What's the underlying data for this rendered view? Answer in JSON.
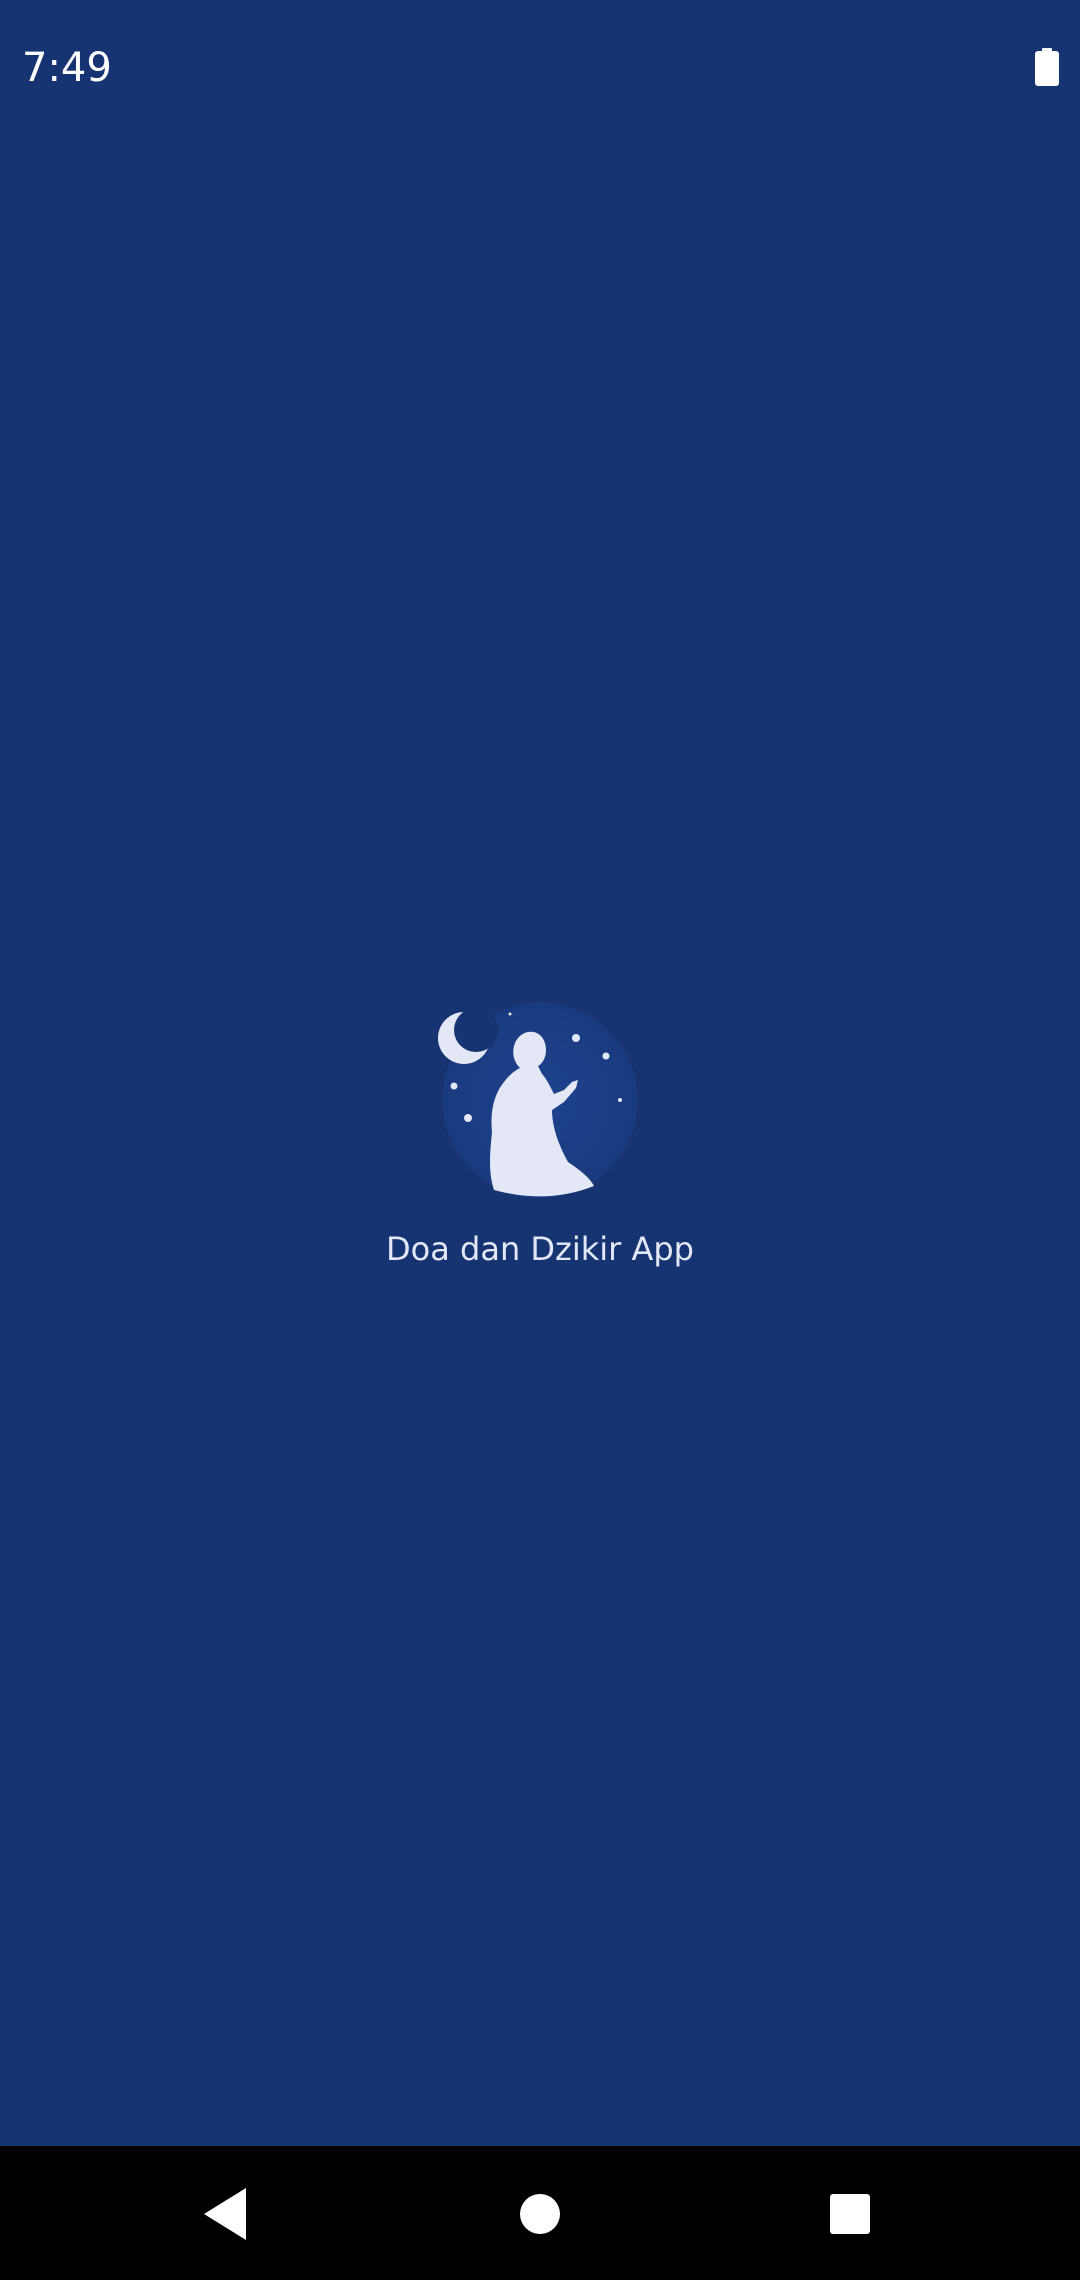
{
  "status_bar": {
    "time": "7:49",
    "battery_icon": "battery-full-icon"
  },
  "splash": {
    "app_name": "Doa dan Dzikir App",
    "logo_icon": "praying-man-moon-logo"
  },
  "nav_bar": {
    "back_icon": "back-triangle-icon",
    "home_icon": "home-circle-icon",
    "recents_icon": "recents-square-icon"
  },
  "colors": {
    "background": "#163472",
    "logo_circle": "#1c3f86",
    "silhouette": "#e4e8f6",
    "nav_background": "#000000"
  }
}
